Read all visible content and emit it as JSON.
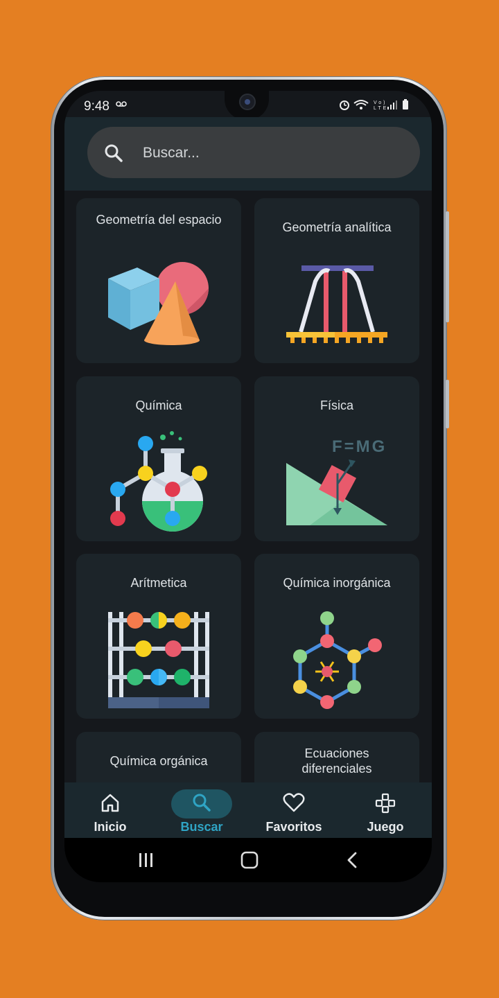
{
  "status": {
    "time": "9:48",
    "voicemail_icon": "voicemail-icon",
    "right_icons": [
      "alarm-icon",
      "wifi-icon",
      "volte-icon",
      "signal-icon",
      "battery-icon"
    ],
    "volte_text": "Vo) LTE"
  },
  "search": {
    "placeholder": "Buscar...",
    "icon": "search-icon"
  },
  "categories": [
    {
      "title": "Geometría del espacio",
      "icon": "solid-shapes-icon"
    },
    {
      "title": "Geometría analítica",
      "icon": "bridge-icon"
    },
    {
      "title": "Química",
      "icon": "chemistry-flask-icon"
    },
    {
      "title": "Física",
      "icon": "inclined-plane-icon",
      "formula": "F=MG"
    },
    {
      "title": "Arítmetica",
      "icon": "abacus-icon"
    },
    {
      "title": "Química inorgánica",
      "icon": "molecule-icon"
    },
    {
      "title": "Química orgánica",
      "icon": ""
    },
    {
      "title": "Ecuaciones diferenciales",
      "icon": ""
    }
  ],
  "bottom_nav": [
    {
      "label": "Inicio",
      "icon": "home-icon",
      "active": false
    },
    {
      "label": "Buscar",
      "icon": "search-icon",
      "active": true
    },
    {
      "label": "Favoritos",
      "icon": "heart-icon",
      "active": false
    },
    {
      "label": "Juego",
      "icon": "gamepad-icon",
      "active": false
    }
  ],
  "colors": {
    "background": "#e47f22",
    "screen": "#15181c",
    "card": "#1c2429",
    "accent": "#2fa4c4",
    "accent_pill": "#1f5562"
  }
}
